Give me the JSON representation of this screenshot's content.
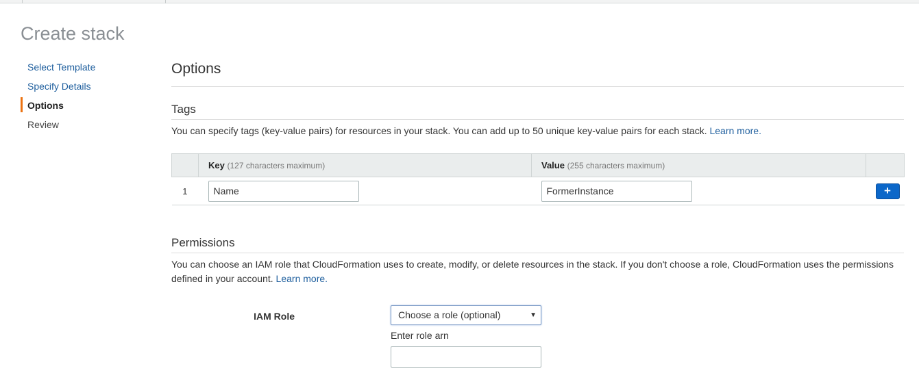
{
  "page": {
    "title": "Create stack"
  },
  "wizard_steps": [
    {
      "label": "Select Template",
      "state": "link"
    },
    {
      "label": "Specify Details",
      "state": "link"
    },
    {
      "label": "Options",
      "state": "active"
    },
    {
      "label": "Review",
      "state": "upcoming"
    }
  ],
  "options": {
    "title": "Options"
  },
  "tags": {
    "title": "Tags",
    "description": "You can specify tags (key-value pairs) for resources in your stack. You can add up to 50 unique key-value pairs for each stack.",
    "learn_more": "Learn more.",
    "columns": {
      "key": "Key",
      "key_hint": "(127 characters maximum)",
      "value": "Value",
      "value_hint": "(255 characters maximum)"
    },
    "rows": [
      {
        "num": "1",
        "key": "Name",
        "value": "FormerInstance"
      }
    ],
    "add_label": "+"
  },
  "permissions": {
    "title": "Permissions",
    "description": "You can choose an IAM role that CloudFormation uses to create, modify, or delete resources in the stack. If you don't choose a role, CloudFormation uses the permissions defined in your account.",
    "learn_more": "Learn more.",
    "iam_role_label": "IAM Role",
    "role_select": "Choose a role (optional)",
    "role_arn_label": "Enter role arn",
    "role_arn_value": ""
  },
  "colors": {
    "accent": "#ec7211",
    "link": "#1f5f9e",
    "primary_button": "#0b67c9"
  }
}
